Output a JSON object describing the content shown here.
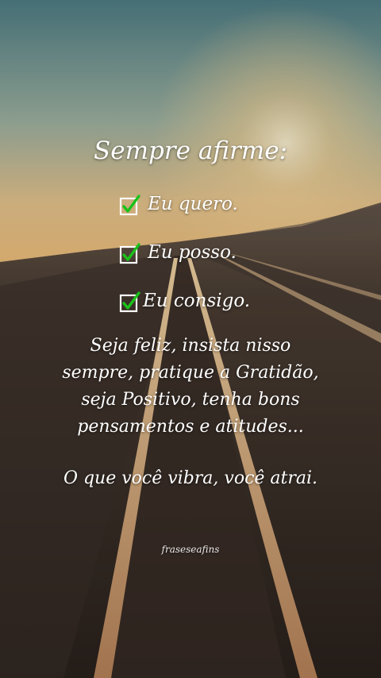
{
  "title": "Sempre afirme:",
  "checklist": [
    {
      "label": "Eu quero.",
      "icon": "checkbox-checked-icon"
    },
    {
      "label": "Eu posso.",
      "icon": "checkbox-checked-icon"
    },
    {
      "label": "Eu consigo.",
      "icon": "checkbox-checked-icon"
    }
  ],
  "body_lines": [
    "Seja feliz, insista nisso",
    "sempre, pratique a Gratidão,",
    "seja Positivo, tenha bons",
    "pensamentos e atitudes..."
  ],
  "closing": "O que você vibra, você atrai.",
  "brand": "fraseseafins",
  "colors": {
    "sky_top": "#5f8f95",
    "sky_mid": "#a8b49c",
    "horizon_glow": "#f4c37e",
    "ground": "#3a2f28",
    "check_green": "#19c21a",
    "text": "#ffffff"
  }
}
